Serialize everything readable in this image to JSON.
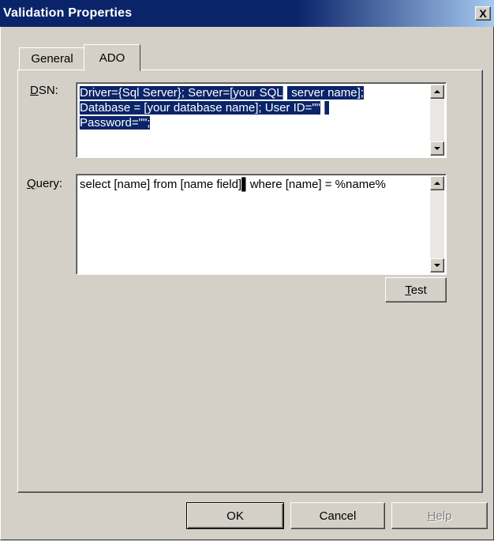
{
  "window": {
    "title": "Validation Properties",
    "close_glyph": "X"
  },
  "tabs": [
    {
      "label": "General",
      "selected": false
    },
    {
      "label": "ADO",
      "selected": true
    }
  ],
  "dsn": {
    "label_mnemonic": "D",
    "label_rest": "SN:",
    "lines": [
      "Driver={Sql Server}; Server=[your SQL▌server name];",
      "Database = [your database name]; User ID=\"\"▌",
      "Password=\"\";"
    ]
  },
  "query": {
    "label_mnemonic": "Q",
    "label_rest": "uery:",
    "value": "select [name] from [name field]▌where [name] = %name%"
  },
  "buttons": {
    "test_mnemonic": "T",
    "test_rest": "est",
    "ok": "OK",
    "cancel": "Cancel",
    "help_mnemonic": "H",
    "help_rest": "elp"
  },
  "colors": {
    "titlebar": "#0a246a",
    "face": "#d4d0c8",
    "selection": "#0a246a"
  }
}
